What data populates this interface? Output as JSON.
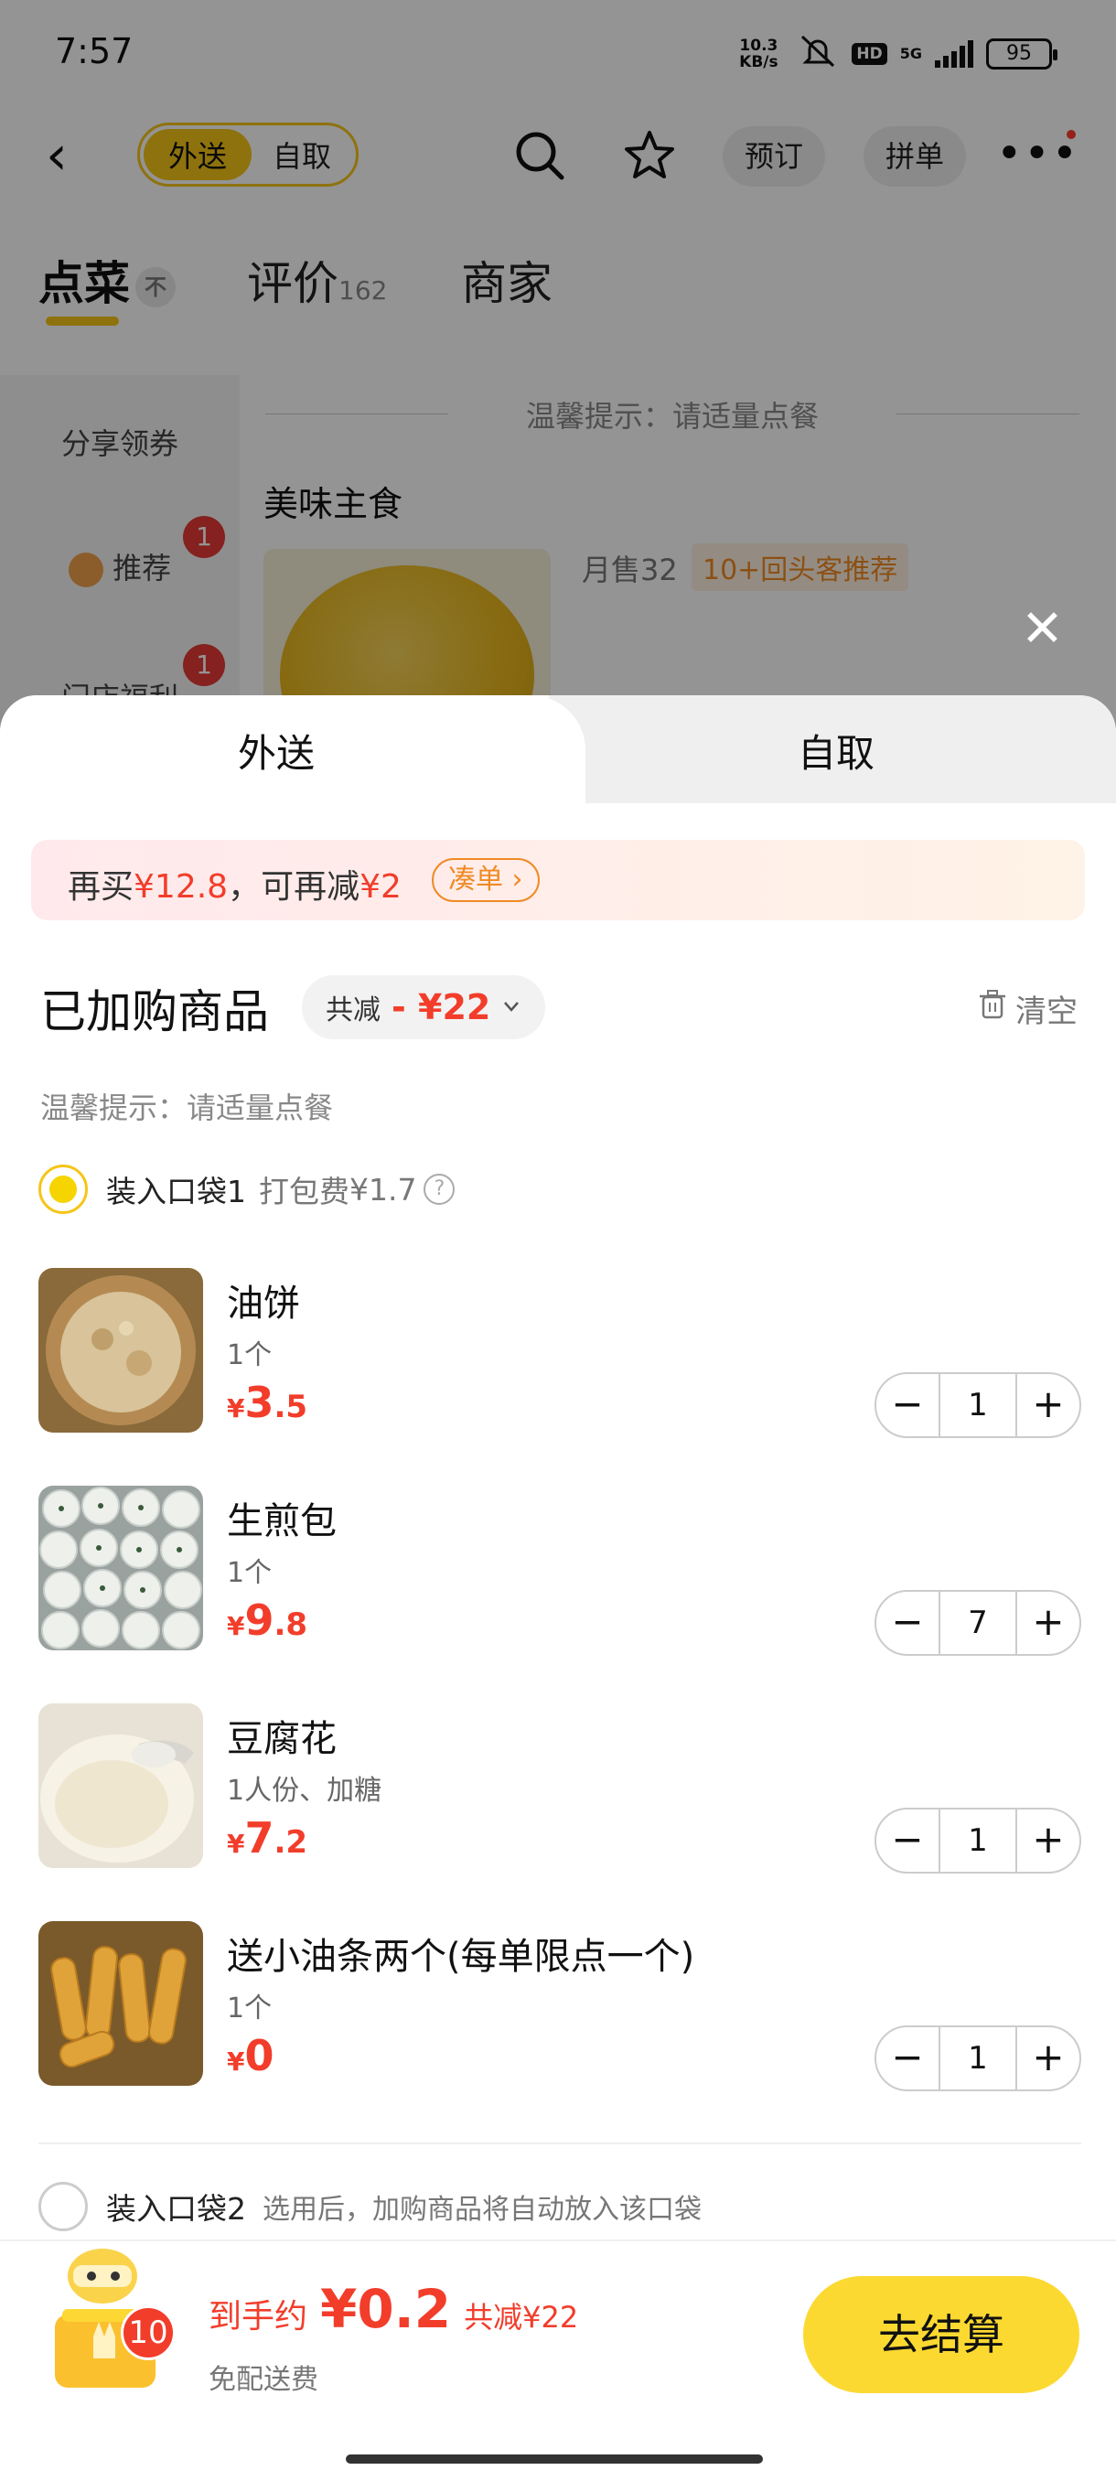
{
  "status_bar": {
    "time": "7:57",
    "net_speed": "10.3 KB/s",
    "hd": "HD",
    "signal": "5G",
    "battery": "95"
  },
  "nav": {
    "delivery": "外送",
    "pickup": "自取",
    "reserve": "预订",
    "group": "拼单"
  },
  "tabs": {
    "order": "点菜",
    "order_icon": "不",
    "reviews": "评价",
    "reviews_count": "162",
    "merchant": "商家"
  },
  "sidebar": {
    "coupons": "分享领券",
    "recommend": "推荐",
    "recommend_badge": "1",
    "store_benefit": "门店福利",
    "store_badge": "1"
  },
  "menu": {
    "hint": "温馨提示：请适量点餐",
    "category": "美味主食",
    "sold": "月售32",
    "tag": "10+回头客推荐"
  },
  "sheet": {
    "tab_delivery": "外送",
    "tab_pickup": "自取",
    "promo": {
      "prefix": "再买",
      "amount1": "¥12.8",
      "mid": "，可再减",
      "amount2": "¥2",
      "button": "凑单 ›"
    },
    "title": "已加购商品",
    "saving_label": "共减",
    "saving_amount": "- ¥22",
    "clear": "清空",
    "hint": "温馨提示：请适量点餐",
    "bag1": {
      "label": "装入口袋1",
      "fee_label": "打包费",
      "fee": "¥1.7"
    },
    "bag2": {
      "label": "装入口袋2",
      "sub": "选用后，加购商品将自动放入该口袋"
    }
  },
  "items": [
    {
      "name": "油饼",
      "spec": "1个",
      "yen": "¥",
      "int": "3",
      "dec": ".5",
      "qty": "1"
    },
    {
      "name": "生煎包",
      "spec": "1个",
      "yen": "¥",
      "int": "9",
      "dec": ".8",
      "qty": "7"
    },
    {
      "name": "豆腐花",
      "spec": "1人份、加糖",
      "yen": "¥",
      "int": "7",
      "dec": ".2",
      "qty": "1"
    },
    {
      "name": "送小油条两个(每单限点一个)",
      "spec": "1个",
      "yen": "¥",
      "int": "0",
      "dec": "",
      "qty": "1"
    }
  ],
  "footer": {
    "cart_count": "10",
    "total_label": "到手约",
    "total": "¥0.2",
    "discount": "共减¥22",
    "free": "免配送费",
    "checkout": "去结算"
  },
  "colors": {
    "accent": "#f5c518",
    "price": "#f23d2b",
    "checkout": "#fcd931"
  }
}
